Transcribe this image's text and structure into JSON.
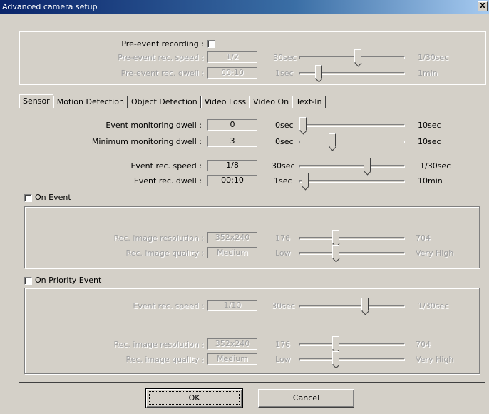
{
  "window": {
    "title": "Advanced camera setup",
    "close_glyph": "X"
  },
  "pre_event": {
    "recording_label": "Pre-event recording :",
    "speed_label": "Pre-event rec. speed :",
    "speed_value": "1/2",
    "speed_min": "30sec",
    "speed_max": "1/30sec",
    "speed_position": 0.56,
    "dwell_label": "Pre-event rec. dwell :",
    "dwell_value": "00:10",
    "dwell_min": "1sec",
    "dwell_max": "1min",
    "dwell_position": 0.16
  },
  "tabs": [
    "Sensor",
    "Motion Detection",
    "Object Detection",
    "Video Loss",
    "Video On",
    "Text-In"
  ],
  "sensor": {
    "event_dwell_label": "Event monitoring dwell :",
    "event_dwell_value": "0",
    "event_dwell_min": "0sec",
    "event_dwell_max": "10sec",
    "event_dwell_position": 0.0,
    "min_dwell_label": "Minimum monitoring dwell :",
    "min_dwell_value": "3",
    "min_dwell_min": "0sec",
    "min_dwell_max": "10sec",
    "min_dwell_position": 0.3,
    "rec_speed_label": "Event rec. speed :",
    "rec_speed_value": "1/8",
    "rec_speed_min": "30sec",
    "rec_speed_max": "1/30sec",
    "rec_speed_position": 0.65,
    "rec_dwell_label": "Event rec. dwell :",
    "rec_dwell_value": "00:10",
    "rec_dwell_min": "1sec",
    "rec_dwell_max": "10min",
    "rec_dwell_position": 0.02
  },
  "on_event": {
    "label": "On Event",
    "resolution_label": "Rec. image resolution :",
    "resolution_value": "352x240",
    "resolution_min": "176",
    "resolution_max": "704",
    "resolution_position": 0.33,
    "quality_label": "Rec. image quality :",
    "quality_value": "Medium",
    "quality_min": "Low",
    "quality_max": "Very High",
    "quality_position": 0.33
  },
  "on_priority_event": {
    "label": "On Priority Event",
    "speed_label": "Event rec. speed :",
    "speed_value": "1/10",
    "speed_min": "30sec",
    "speed_max": "1/30sec",
    "speed_position": 0.63,
    "resolution_label": "Rec. image resolution :",
    "resolution_value": "352x240",
    "resolution_min": "176",
    "resolution_max": "704",
    "resolution_position": 0.33,
    "quality_label": "Rec. image quality :",
    "quality_value": "Medium",
    "quality_min": "Low",
    "quality_max": "Very High",
    "quality_position": 0.33
  },
  "buttons": {
    "ok": "OK",
    "cancel": "Cancel"
  }
}
